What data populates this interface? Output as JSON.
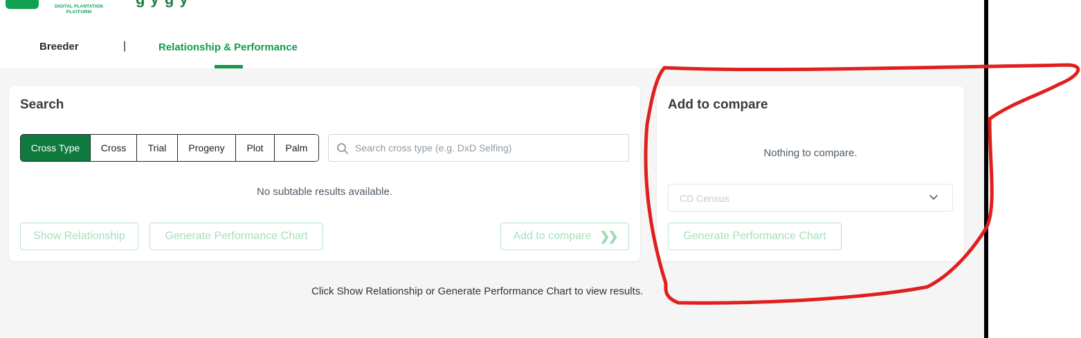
{
  "header": {
    "logo_text": "DIGITAL PLANTATION PLATFORM",
    "title_peek": "g   y     g         y",
    "tabs": [
      {
        "label": "Breeder"
      },
      {
        "label": "|"
      },
      {
        "label": "Relationship & Performance"
      }
    ]
  },
  "search_card": {
    "title": "Search",
    "segments": [
      "Cross Type",
      "Cross",
      "Trial",
      "Progeny",
      "Plot",
      "Palm"
    ],
    "active_segment": "Cross Type",
    "search_placeholder": "Search cross type (e.g. DxD Selfing)",
    "empty_message": "No subtable results available.",
    "buttons": {
      "show_relationship": "Show Relationship",
      "generate_chart": "Generate Performance Chart",
      "add_to_compare": "Add to compare"
    }
  },
  "compare_card": {
    "title": "Add to compare",
    "empty_message": "Nothing to compare.",
    "select_value": "CD Census",
    "generate_chart": "Generate Performance Chart"
  },
  "footer_message": "Click Show Relationship or Generate Performance Chart to view results.",
  "colors": {
    "brand_green": "#139a4c",
    "active_segment": "#0e7a3e",
    "annotation_red": "#e01f1f"
  }
}
